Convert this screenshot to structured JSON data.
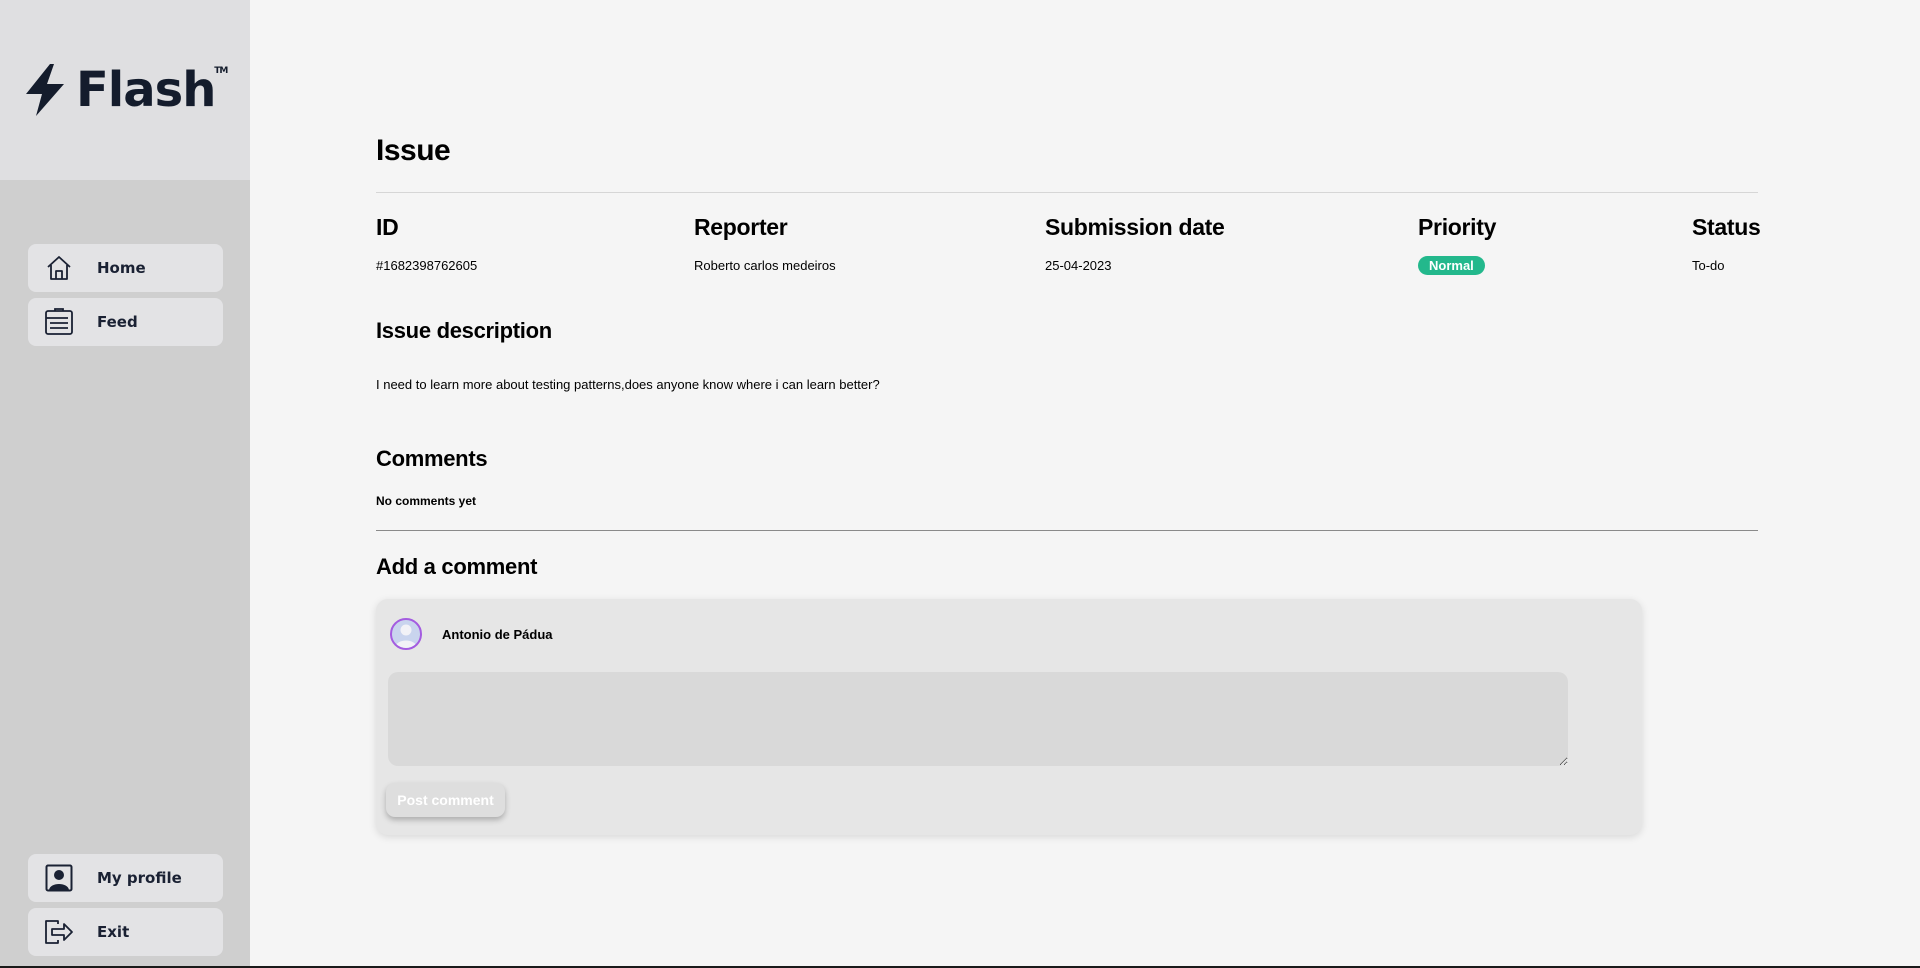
{
  "app": {
    "logo_text": "Flash",
    "trademark": "TM"
  },
  "sidebar": {
    "top_items": [
      {
        "label": "Home",
        "icon": "home-icon"
      },
      {
        "label": "Feed",
        "icon": "feed-icon"
      }
    ],
    "bottom_items": [
      {
        "label": "My profile",
        "icon": "profile-icon"
      },
      {
        "label": "Exit",
        "icon": "exit-icon"
      }
    ]
  },
  "issue": {
    "title": "Issue",
    "columns": {
      "id": {
        "label": "ID",
        "value": "#1682398762605"
      },
      "reporter": {
        "label": "Reporter",
        "value": "Roberto carlos medeiros"
      },
      "submission_date": {
        "label": "Submission date",
        "value": "25-04-2023"
      },
      "priority": {
        "label": "Priority",
        "value": "Normal",
        "color": "#23b88c"
      },
      "status": {
        "label": "Status",
        "value": "To-do"
      }
    },
    "description_title": "Issue description",
    "description": "I need to learn more about testing patterns,does anyone know where i can learn better?"
  },
  "comments": {
    "title": "Comments",
    "empty_text": "No comments yet"
  },
  "add_comment": {
    "title": "Add a comment",
    "author": "Antonio de Pádua",
    "input_value": "",
    "post_label": "Post comment"
  }
}
